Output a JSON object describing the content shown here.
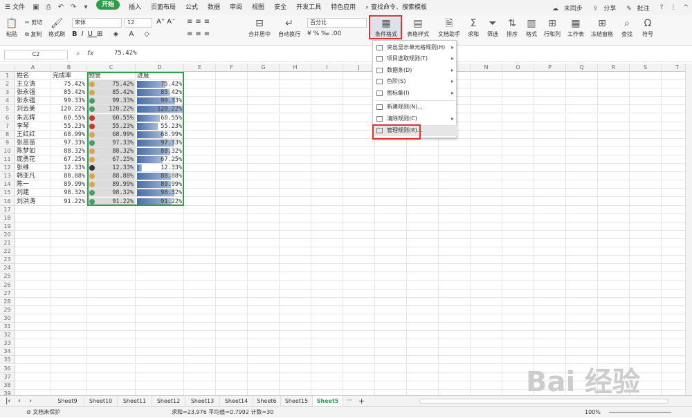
{
  "menu": {
    "file": "文件",
    "tabs": [
      "开始",
      "插入",
      "页面布局",
      "公式",
      "数据",
      "审阅",
      "视图",
      "安全",
      "开发工具",
      "特色应用"
    ],
    "search": "查找命令、搜索模板",
    "sync": "未同步",
    "share": "分享",
    "comment": "批注"
  },
  "ribbon": {
    "paste": "粘贴",
    "cut": "剪切",
    "copy": "复制",
    "format_painter": "格式刷",
    "font": "宋体",
    "size": "12",
    "merge": "合并居中",
    "wrap": "自动换行",
    "number_format": "百分比",
    "cond_format": "条件格式",
    "table_style": "表格样式",
    "doc_helper": "文档助手",
    "sum": "求和",
    "filter": "筛选",
    "sort": "排序",
    "format": "格式",
    "rowcol": "行和列",
    "sheet": "工作表",
    "freeze": "冻结窗格",
    "find": "查找",
    "symbol": "符号"
  },
  "formula": {
    "cell": "C2",
    "fx": "fx",
    "value": "75.42%"
  },
  "columns": [
    "A",
    "B",
    "C",
    "D",
    "E",
    "F",
    "G",
    "H",
    "I",
    "J",
    "K",
    "L",
    "M",
    "N",
    "O",
    "P",
    "Q",
    "R",
    "S",
    "T"
  ],
  "headers": {
    "a": "姓名",
    "b": "完成率",
    "c": "预警",
    "d": "进度"
  },
  "rows": [
    {
      "name": "王立涛",
      "pct": "75.42%",
      "val": 0.7542,
      "dot": "#d4a84a"
    },
    {
      "name": "张永强",
      "pct": "85.42%",
      "val": 0.8542,
      "dot": "#d4a84a"
    },
    {
      "name": "张永强",
      "pct": "99.33%",
      "val": 0.9933,
      "dot": "#4a9a6a"
    },
    {
      "name": "刘云美",
      "pct": "120.22%",
      "val": 1.2022,
      "dot": "#4a9a6a"
    },
    {
      "name": "朱志辉",
      "pct": "60.55%",
      "val": 0.6055,
      "dot": "#c0392b"
    },
    {
      "name": "李琴",
      "pct": "55.23%",
      "val": 0.5523,
      "dot": "#c0392b"
    },
    {
      "name": "王红红",
      "pct": "68.99%",
      "val": 0.6899,
      "dot": "#d4a84a"
    },
    {
      "name": "张苗苗",
      "pct": "97.33%",
      "val": 0.9733,
      "dot": "#4a9a6a"
    },
    {
      "name": "陈梦如",
      "pct": "88.32%",
      "val": 0.8832,
      "dot": "#d4a84a"
    },
    {
      "name": "庞勇花",
      "pct": "67.25%",
      "val": 0.6725,
      "dot": "#d4a84a"
    },
    {
      "name": "张维",
      "pct": "12.33%",
      "val": 0.1233,
      "dot": "#333333"
    },
    {
      "name": "韩亚凡",
      "pct": "88.88%",
      "val": 0.8888,
      "dot": "#d4a84a"
    },
    {
      "name": "陈一",
      "pct": "89.99%",
      "val": 0.8999,
      "dot": "#d4a84a"
    },
    {
      "name": "刘建",
      "pct": "98.32%",
      "val": 0.9832,
      "dot": "#4a9a6a"
    },
    {
      "name": "刘洪涛",
      "pct": "91.22%",
      "val": 0.9122,
      "dot": "#4a9a6a"
    }
  ],
  "row_count": 39,
  "dropdown": [
    "突出显示单元格规则(H)",
    "项目选取规则(T)",
    "数据条(D)",
    "色阶(S)",
    "图标集(I)",
    "新建规则(N)...",
    "清除规则(C)",
    "管理规则(R)..."
  ],
  "sheets": [
    "Sheet9",
    "Sheet10",
    "Sheet11",
    "Sheet12",
    "Sheet13",
    "Sheet14",
    "Sheet6",
    "Sheet15",
    "Sheet5"
  ],
  "active_sheet": "Sheet5",
  "status": {
    "protect": "文档未保护",
    "stats": "求和=23.976  平均值=0.7992  计数=30",
    "zoom": "100%"
  },
  "watermark": "Bai 经验"
}
